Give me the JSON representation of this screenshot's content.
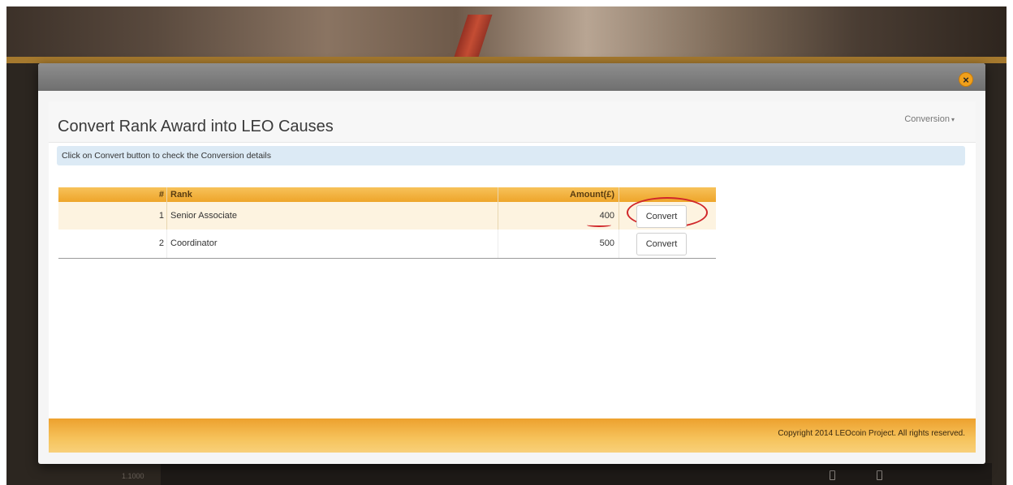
{
  "modal": {
    "close_label": "×",
    "title": "Convert Rank Award into LEO Causes",
    "menu_label": "Conversion",
    "info_text": "Click on Convert button to check the Conversion details",
    "table": {
      "headers": {
        "num": "#",
        "rank": "Rank",
        "amount": "Amount(£)"
      },
      "rows": [
        {
          "num": "1",
          "rank": "Senior Associate",
          "amount": "400",
          "action": "Convert"
        },
        {
          "num": "2",
          "rank": "Coordinator",
          "amount": "500",
          "action": "Convert"
        }
      ]
    },
    "copyright": "Copyright 2014 LEOcoin Project. All rights reserved."
  },
  "background": {
    "footer_text": "1.1000"
  },
  "colors": {
    "accent": "#f0a932",
    "annotation": "#d0262a",
    "info_bar": "#dceaf5"
  },
  "icons": {
    "close": "close-circle-icon",
    "menu_caret": "caret-down-icon"
  }
}
